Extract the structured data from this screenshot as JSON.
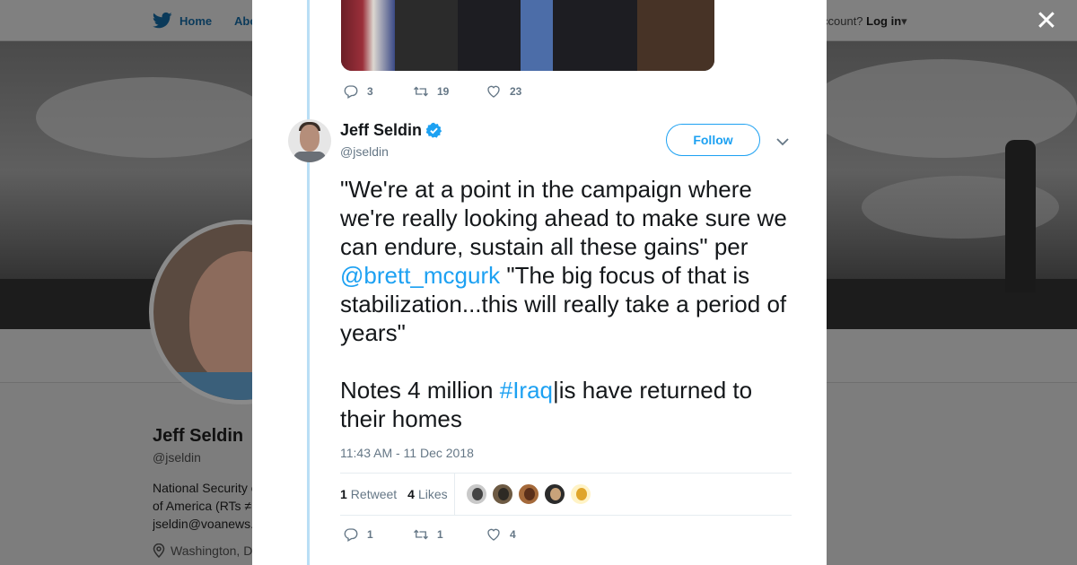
{
  "topbar": {
    "home_label": "Home",
    "about_label": "Abo",
    "account_prompt": "ccount?",
    "login_label": "Log in",
    "caret": "▾",
    "close_symbol": "✕"
  },
  "profile": {
    "name": "Jeff Seldin",
    "handle": "@jseldin",
    "bio_lines": [
      "National Security c",
      "of America (RTs ≠",
      "jseldin@voanews."
    ],
    "location": "Washington, D"
  },
  "previous_tweet": {
    "replies": "3",
    "retweets": "19",
    "likes": "23"
  },
  "tweet": {
    "author_name": "Jeff Seldin",
    "author_handle": "@jseldin",
    "follow_label": "Follow",
    "text_p1_before": "\"We're at a point in the campaign where we're really looking ahead to make sure we can endure, sustain all these gains\" per ",
    "mention": "@brett_mcgurk",
    "text_p1_after": " \"The big focus of that is stabilization...this will really take a period of years\"",
    "text_p2_before": "Notes 4 million ",
    "hashtag": "#Iraq",
    "text_p2_after": "|is  have returned to their homes",
    "timestamp": "11:43 AM - 11 Dec 2018",
    "retweet_count": "1",
    "retweet_label": "Retweet",
    "like_count": "4",
    "like_label": "Likes",
    "replies": "1",
    "retweets": "1",
    "likes": "4"
  },
  "colors": {
    "accent": "#1da1f2",
    "secondary_text": "#657786",
    "thread_line": "#b9def5",
    "overlay": "#7d7d7d"
  },
  "icons": [
    "twitter-bird-icon",
    "close-icon",
    "reply-icon",
    "retweet-icon",
    "like-icon",
    "verified-badge-icon",
    "chevron-down-icon",
    "location-pin-icon"
  ]
}
